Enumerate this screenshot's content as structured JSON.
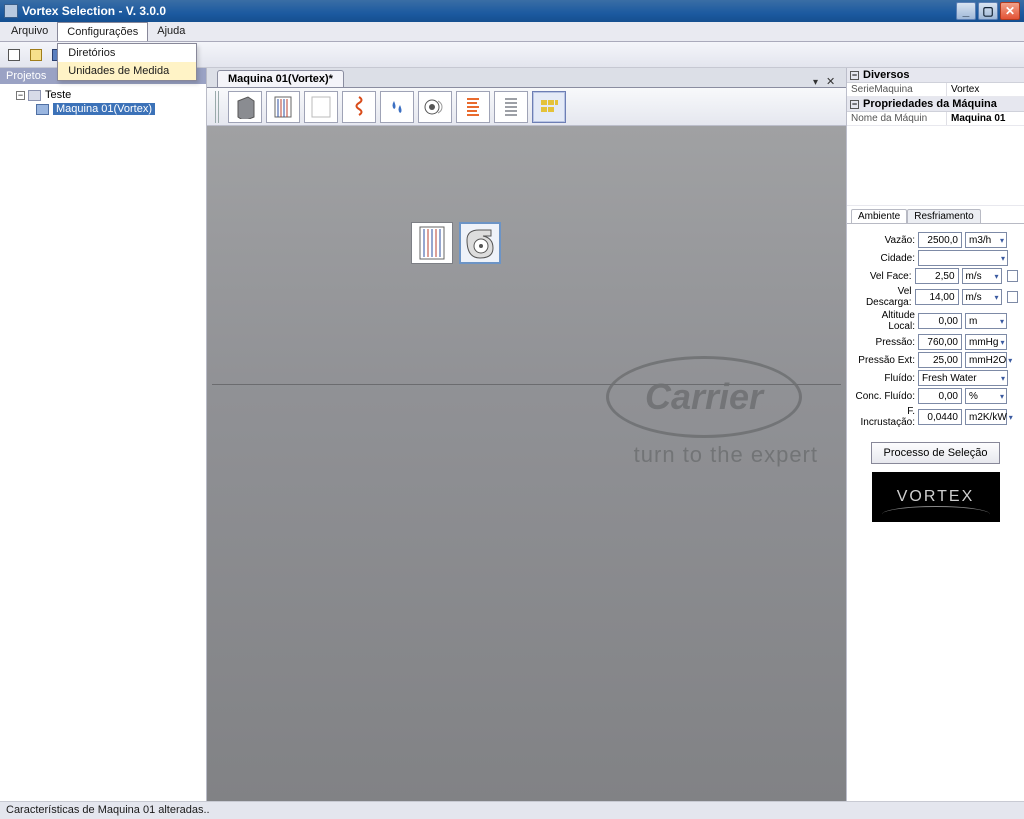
{
  "window": {
    "title": "Vortex Selection - V. 3.0.0"
  },
  "menu": {
    "items": [
      {
        "label": "Arquivo"
      },
      {
        "label": "Configurações"
      },
      {
        "label": "Ajuda"
      }
    ],
    "config_dropdown": {
      "items": [
        {
          "label": "Diretórios"
        },
        {
          "label": "Unidades de Medida"
        }
      ]
    }
  },
  "side": {
    "title": "Projetos",
    "root": "Teste",
    "child": "Maquina 01(Vortex)"
  },
  "doc_tab": {
    "label": "Maquina 01(Vortex)*"
  },
  "carrier": {
    "brand": "Carrier",
    "tag": "turn to the expert"
  },
  "propgrid": {
    "diversos": {
      "header": "Diversos",
      "serie_label": "SerieMaquina",
      "serie_value": "Vortex"
    },
    "props": {
      "header": "Propriedades da Máquina",
      "nome_label": "Nome da Máquin",
      "nome_value": "Maquina 01"
    }
  },
  "tabs": {
    "ambiente": "Ambiente",
    "resfriamento": "Resfriamento"
  },
  "form": {
    "vazao": {
      "label": "Vazão:",
      "value": "2500,0",
      "unit": "m3/h"
    },
    "cidade": {
      "label": "Cidade:"
    },
    "velface": {
      "label": "Vel Face:",
      "value": "2,50",
      "unit": "m/s"
    },
    "veldes": {
      "label": "Vel Descarga:",
      "value": "14,00",
      "unit": "m/s"
    },
    "altitude": {
      "label": "Altitude Local:",
      "value": "0,00",
      "unit": "m"
    },
    "pressao": {
      "label": "Pressão:",
      "value": "760,00",
      "unit": "mmHg"
    },
    "pressaoext": {
      "label": "Pressão Ext:",
      "value": "25,00",
      "unit": "mmH2O"
    },
    "fluido": {
      "label": "Fluído:",
      "value": "Fresh Water"
    },
    "concfluido": {
      "label": "Conc. Fluído:",
      "value": "0,00",
      "unit": "%"
    },
    "fincr": {
      "label": "F. Incrustação:",
      "value": "0,0440",
      "unit": "m2K/kW"
    }
  },
  "buttons": {
    "process": "Processo de Seleção"
  },
  "logo": {
    "text": "VORTEX"
  },
  "status": "Características de Maquina 01 alteradas.."
}
